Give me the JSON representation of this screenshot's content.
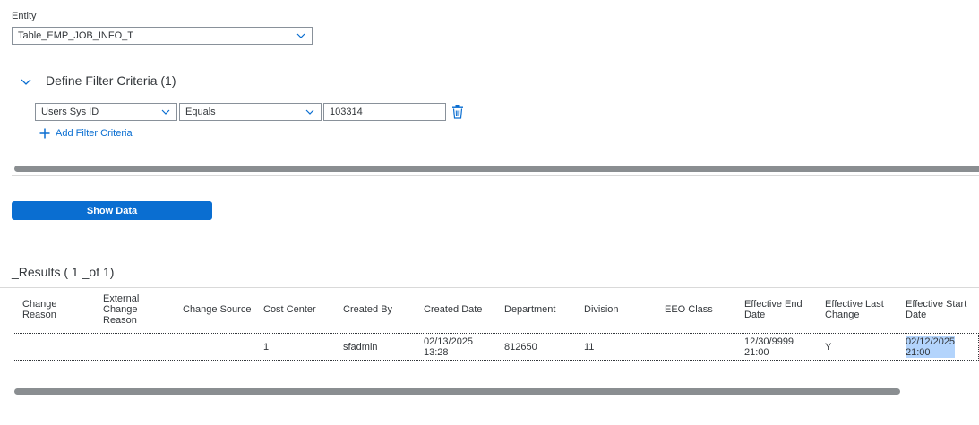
{
  "entity": {
    "label": "Entity",
    "selected": "Table_EMP_JOB_INFO_T"
  },
  "filter": {
    "title": "Define Filter Criteria (1)",
    "field": "Users Sys ID",
    "operator": "Equals",
    "value": "103314",
    "add_label": "Add Filter Criteria"
  },
  "actions": {
    "show_data": "Show Data"
  },
  "results": {
    "title": "_Results ( 1 _of 1)",
    "columns": [
      "Change\nReason",
      "External\nChange\nReason",
      "Change Source",
      "Cost Center",
      "Created By",
      "Created Date",
      "Department",
      "Division",
      "EEO Class",
      "Effective End\nDate",
      "Effective Last\nChange",
      "Effective Start\nDate"
    ],
    "rows": [
      [
        "",
        "",
        "",
        "1",
        "sfadmin",
        "02/13/2025\n13:28",
        "812650",
        "11",
        "",
        "12/30/9999\n21:00",
        "Y",
        "02/12/2025\n21:00"
      ]
    ]
  },
  "colors": {
    "accent": "#0a6ed1",
    "selection": "#b3d4fc",
    "scrollbar": "#8a8e91"
  },
  "icons": {
    "entity_dropdown": "chevron-down-icon",
    "filter_toggle": "chevron-down-icon",
    "delete": "trash-icon",
    "add": "plus-icon"
  }
}
